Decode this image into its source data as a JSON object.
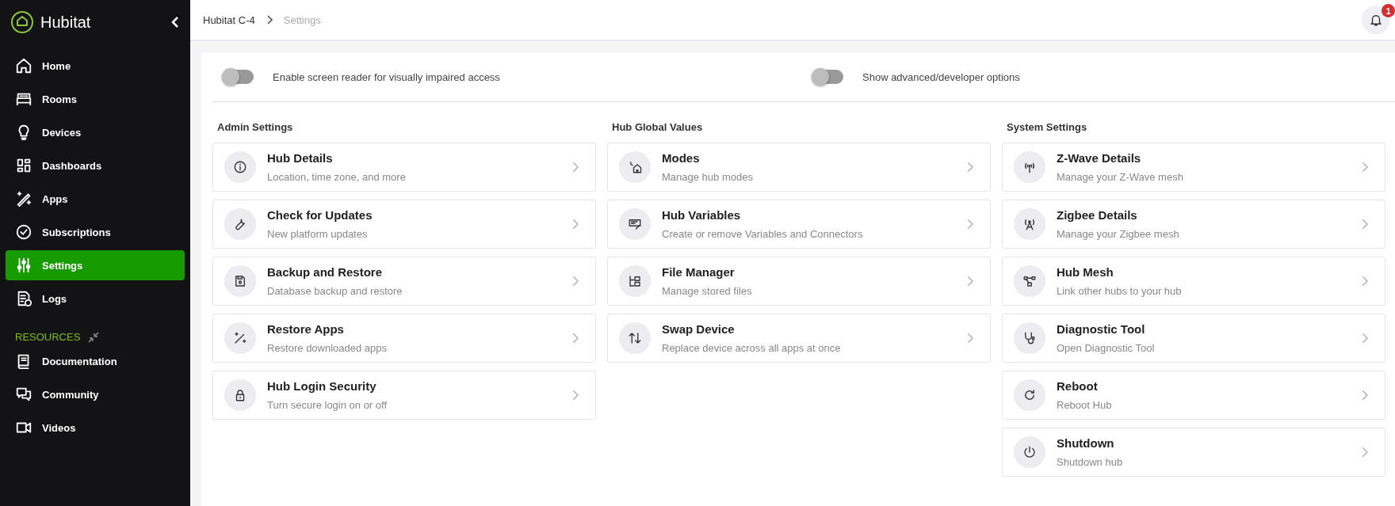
{
  "sidebar": {
    "brand": "Hubitat",
    "items": [
      {
        "label": "Home",
        "selected": false
      },
      {
        "label": "Rooms",
        "selected": false
      },
      {
        "label": "Devices",
        "selected": false
      },
      {
        "label": "Dashboards",
        "selected": false
      },
      {
        "label": "Apps",
        "selected": false
      },
      {
        "label": "Subscriptions",
        "selected": false
      },
      {
        "label": "Settings",
        "selected": true
      },
      {
        "label": "Logs",
        "selected": false
      }
    ],
    "resources_heading": "RESOURCES",
    "resources": [
      {
        "label": "Documentation"
      },
      {
        "label": "Community"
      },
      {
        "label": "Videos"
      }
    ]
  },
  "breadcrumb": [
    "Hubitat C-4",
    "Settings"
  ],
  "notifications": {
    "badge": "1"
  },
  "toggles": [
    {
      "label": "Enable screen reader for visually impaired access",
      "on": false
    },
    {
      "label": "Show advanced/developer options",
      "on": false
    }
  ],
  "sections": [
    {
      "title": "Admin Settings",
      "cards": [
        {
          "title": "Hub Details",
          "subtitle": "Location, time zone, and more"
        },
        {
          "title": "Check for Updates",
          "subtitle": "New platform updates"
        },
        {
          "title": "Backup and Restore",
          "subtitle": "Database backup and restore"
        },
        {
          "title": "Restore Apps",
          "subtitle": "Restore downloaded apps"
        },
        {
          "title": "Hub Login Security",
          "subtitle": "Turn secure login on or off"
        }
      ]
    },
    {
      "title": "Hub Global Values",
      "cards": [
        {
          "title": "Modes",
          "subtitle": "Manage hub modes"
        },
        {
          "title": "Hub Variables",
          "subtitle": "Create or remove Variables and Connectors"
        },
        {
          "title": "File Manager",
          "subtitle": "Manage stored files"
        },
        {
          "title": "Swap Device",
          "subtitle": "Replace device across all apps at once"
        }
      ]
    },
    {
      "title": "System Settings",
      "cards": [
        {
          "title": "Z-Wave Details",
          "subtitle": "Manage your Z-Wave mesh"
        },
        {
          "title": "Zigbee Details",
          "subtitle": "Manage your Zigbee mesh"
        },
        {
          "title": "Hub Mesh",
          "subtitle": "Link other hubs to your hub"
        },
        {
          "title": "Diagnostic Tool",
          "subtitle": "Open Diagnostic Tool"
        },
        {
          "title": "Reboot",
          "subtitle": "Reboot Hub"
        },
        {
          "title": "Shutdown",
          "subtitle": "Shutdown hub"
        }
      ]
    }
  ]
}
